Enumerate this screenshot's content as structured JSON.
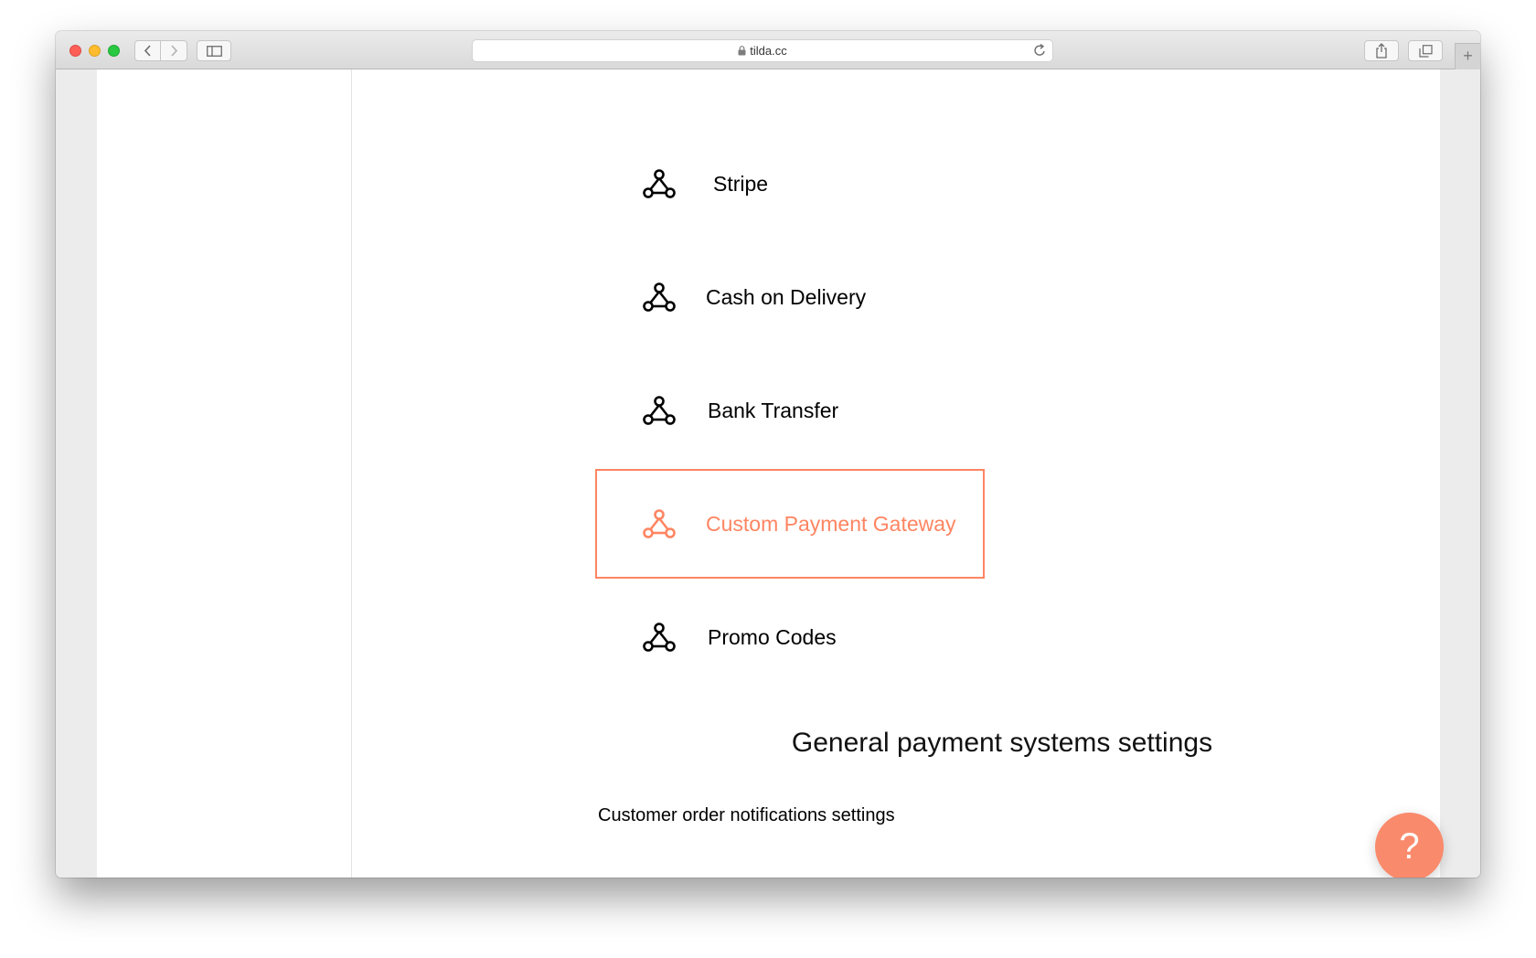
{
  "browser": {
    "url": "tilda.cc"
  },
  "payment_systems": [
    {
      "label": "Stripe",
      "active": false
    },
    {
      "label": "Cash on Delivery",
      "active": false
    },
    {
      "label": "Bank Transfer",
      "active": false
    },
    {
      "label": "Custom Payment Gateway",
      "active": true
    },
    {
      "label": "Promo Codes",
      "active": false
    }
  ],
  "general": {
    "heading": "General payment systems settings",
    "notifications_link": "Customer order notifications settings"
  },
  "help_button": {
    "label": "?"
  },
  "colors": {
    "accent": "#ff8562",
    "help_button": "#fa8a6c"
  },
  "icons": {
    "integration": "network-nodes-icon"
  }
}
